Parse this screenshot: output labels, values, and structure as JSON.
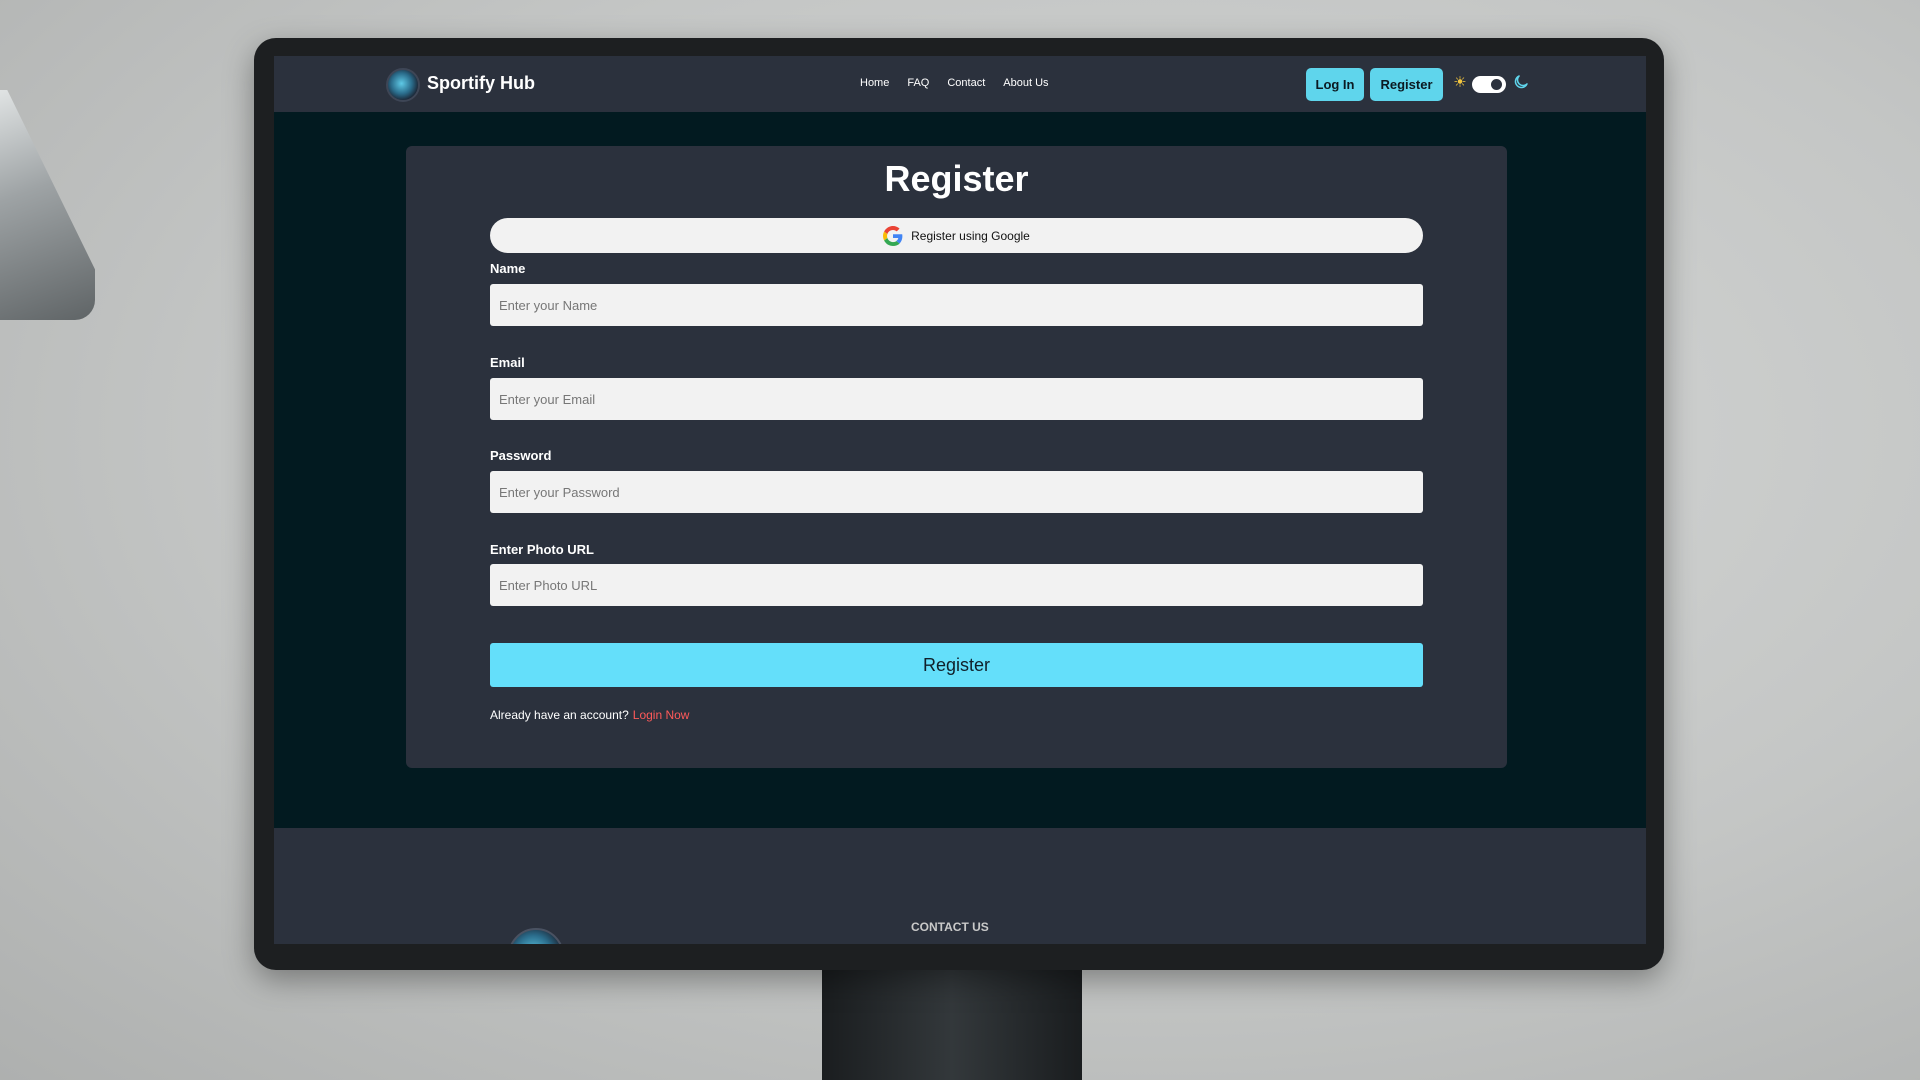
{
  "navbar": {
    "brand": "Sportify Hub",
    "links": [
      "Home",
      "FAQ",
      "Contact",
      "About Us"
    ],
    "login_label": "Log In",
    "register_label": "Register"
  },
  "form": {
    "title": "Register",
    "google_label": "Register using Google",
    "fields": [
      {
        "label": "Name",
        "placeholder": "Enter your Name"
      },
      {
        "label": "Email",
        "placeholder": "Enter your Email"
      },
      {
        "label": "Password",
        "placeholder": "Enter your Password"
      },
      {
        "label": "Enter Photo URL",
        "placeholder": "Enter Photo URL"
      }
    ],
    "submit_label": "Register",
    "already_text": "Already have an account?",
    "login_link": "Login Now"
  },
  "footer": {
    "heading": "CONTACT US"
  },
  "theme": {
    "accent": "#64dffa",
    "panel": "#2b313d",
    "page_bg": "#021a20",
    "link_red": "#ff5a5a"
  },
  "icons": {
    "sun": "sun-icon",
    "moon": "moon-icon",
    "google": "google-icon",
    "logo": "logo-icon"
  }
}
